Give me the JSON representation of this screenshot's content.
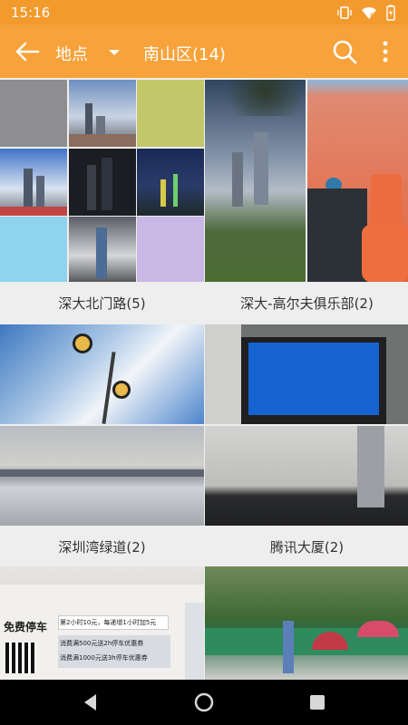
{
  "status": {
    "time": "15:16"
  },
  "appbar": {
    "location_label": "地点",
    "title": "南山区(14)"
  },
  "albums": [
    {
      "caption": "深大北门路(5)"
    },
    {
      "caption": "深大-高尔夫俱乐部(2)"
    },
    {
      "caption": "深圳湾绿道(2)"
    },
    {
      "caption": "腾讯大厦(2)"
    }
  ],
  "parking_sign": {
    "title": "免费停车",
    "line1": "第2小时10元，每递增1小时加5元",
    "line2": "消费满500元送2h停车优惠券",
    "line3": "消费满1000元送3h停车优惠券"
  },
  "colors": {
    "accent": "#f7a23a",
    "status": "#f39a2d"
  }
}
